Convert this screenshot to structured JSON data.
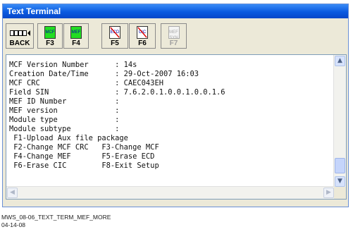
{
  "window": {
    "title": "Text Terminal"
  },
  "toolbar": {
    "buttons": [
      {
        "label": "BACK",
        "icon": "back-key-icon",
        "enabled": true
      },
      {
        "label": "F3",
        "icon_text": "MCF",
        "icon": "mcf-key-icon",
        "enabled": true
      },
      {
        "label": "F4",
        "icon_text": "MEF",
        "icon": "mef-key-icon",
        "enabled": true
      },
      {
        "label": "F5",
        "icon_text": "ECD",
        "icon": "ecd-key-icon",
        "enabled": true
      },
      {
        "label": "F6",
        "icon_text": "CIC",
        "icon": "cic-key-icon",
        "enabled": true
      },
      {
        "label": "F7",
        "icon_text": "MEF SYN",
        "icon": "f7-key-icon",
        "enabled": false
      }
    ]
  },
  "terminal": {
    "lines": [
      "MCF Version Number      : 14s",
      "Creation Date/Time      : 29-Oct-2007 16:03",
      "MCF CRC                 : CAEC043EH",
      "Field SIN               : 7.6.2.0.1.0.0.1.0.0.1.6",
      "MEF ID Number           :",
      "MEF version             :",
      "Module type             :",
      "Module subtype          :",
      " F1-Upload Aux file package",
      " F2-Change MCF CRC   F3-Change MCF",
      " F4-Change MEF       F5-Erase ECD",
      " F6-Erase CIC        F8-Exit Setup"
    ]
  },
  "caption": {
    "line1": "MWS_08-06_TEXT_TERM_MEF_MORE",
    "line2": "04-14-08"
  },
  "colors": {
    "titlebar": "#0a5ae0",
    "key_green": "#22dd22",
    "cross_red": "#dd0000"
  }
}
